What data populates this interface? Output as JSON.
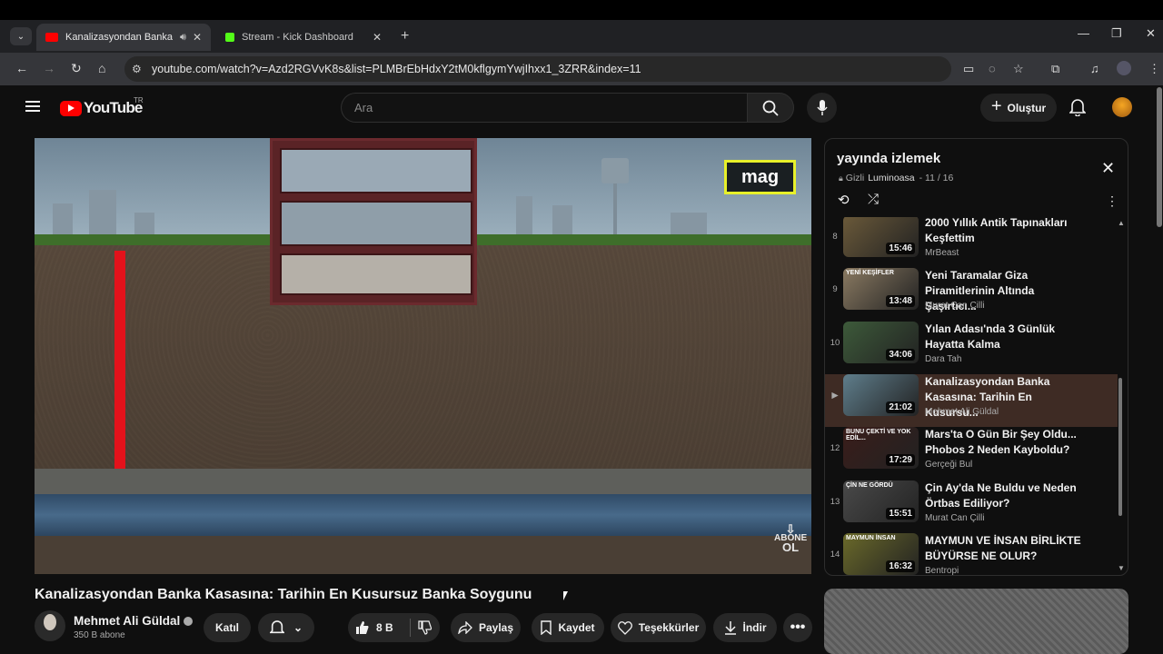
{
  "browser": {
    "tabs": [
      {
        "title": "Kanalizasyondan Banka Kas",
        "favicon_color": "#ff0000",
        "active": true
      },
      {
        "title": "Stream - Kick Dashboard",
        "favicon_color": "#53fc18",
        "active": false
      }
    ],
    "new_tab": "+",
    "url": "youtube.com/watch?v=Azd2RGVvK8s&list=PLMBrEbHdxY2tM0kflgymYwjIhxx1_3ZRR&index=11"
  },
  "youtube": {
    "logo_text": "YouTube",
    "country": "TR",
    "search_placeholder": "Ara",
    "create_label": "Oluştur"
  },
  "video": {
    "overlay_badge": "mag",
    "subscribe_watermark_line1": "ABONE",
    "subscribe_watermark_line2": "OL",
    "title": "Kanalizasyondan Banka Kasasına: Tarihin En Kusursuz Banka Soygunu",
    "channel_name": "Mehmet Ali Güldal",
    "subscribers": "350 B abone",
    "actions": {
      "join": "Katıl",
      "likes": "8 B",
      "share": "Paylaş",
      "save": "Kaydet",
      "thanks": "Teşekkürler",
      "download": "İndir"
    }
  },
  "playlist": {
    "title": "yayında izlemek",
    "privacy": "Gizli",
    "owner": "Luminoasa",
    "position": "- 11 / 16",
    "items": [
      {
        "index": "8",
        "title": "2000 Yıllık Antik Tapınakları Keşfettim",
        "channel": "MrBeast",
        "duration": "15:46",
        "thumb": "#6b5a3a"
      },
      {
        "index": "9",
        "title": "Yeni Taramalar Giza Piramitlerinin Altında Şaşırtıcı...",
        "channel": "Murat Can Çilli",
        "duration": "13:48",
        "thumb": "#8a7a62",
        "thumb_text": "YENİ KEŞİFLER"
      },
      {
        "index": "10",
        "title": "Yılan Adası'nda 3 Günlük Hayatta Kalma",
        "channel": "Dara Tah",
        "duration": "34:06",
        "thumb": "#3d5a3a"
      },
      {
        "index": "▶",
        "title": "Kanalizasyondan Banka Kasasına: Tarihin En Kusursu...",
        "channel": "Mehmet Ali Güldal",
        "duration": "21:02",
        "thumb": "#5f7e8c",
        "current": true
      },
      {
        "index": "12",
        "title": "Mars'ta O Gün Bir Şey Oldu... Phobos 2 Neden Kayboldu?",
        "channel": "Gerçeği Bul",
        "duration": "17:29",
        "thumb": "#3a1d1a",
        "thumb_text": "BUNU ÇEKTİ VE YOK EDİL..."
      },
      {
        "index": "13",
        "title": "Çin Ay'da Ne Buldu ve Neden Örtbas Ediliyor?",
        "channel": "Murat Can Çilli",
        "duration": "15:51",
        "thumb": "#4a4a4a",
        "thumb_text": "ÇİN NE GÖRDÜ"
      },
      {
        "index": "14",
        "title": "MAYMUN VE İNSAN BİRLİKTE BÜYÜRSE NE OLUR?",
        "channel": "Bentropi",
        "duration": "16:32",
        "thumb": "#6b6a2a",
        "thumb_text": "MAYMUN İNSAN"
      }
    ]
  }
}
